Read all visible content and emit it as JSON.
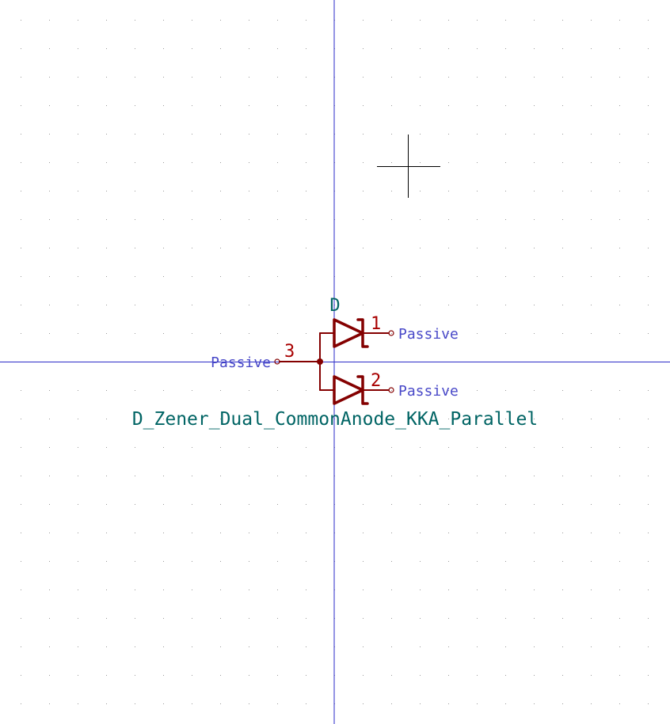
{
  "colors": {
    "background": "#ffffff",
    "grid_dot": "#9a9a9a",
    "axis": "#2a2ac8",
    "symbol": "#840000",
    "pin_number": "#a80000",
    "pin_type": "#4848c8",
    "field_text": "#006464",
    "cursor": "#000000"
  },
  "symbol": {
    "reference": "D",
    "value": "D_Zener_Dual_CommonAnode_KKA_Parallel",
    "pins": [
      {
        "number": "1",
        "type": "Passive"
      },
      {
        "number": "2",
        "type": "Passive"
      },
      {
        "number": "3",
        "type": "Passive"
      }
    ]
  },
  "icons": {
    "cursor": "crosshair-cursor-icon",
    "diode_top": "zener-diode-icon",
    "diode_bottom": "zener-diode-icon",
    "junction": "junction-dot-icon"
  }
}
